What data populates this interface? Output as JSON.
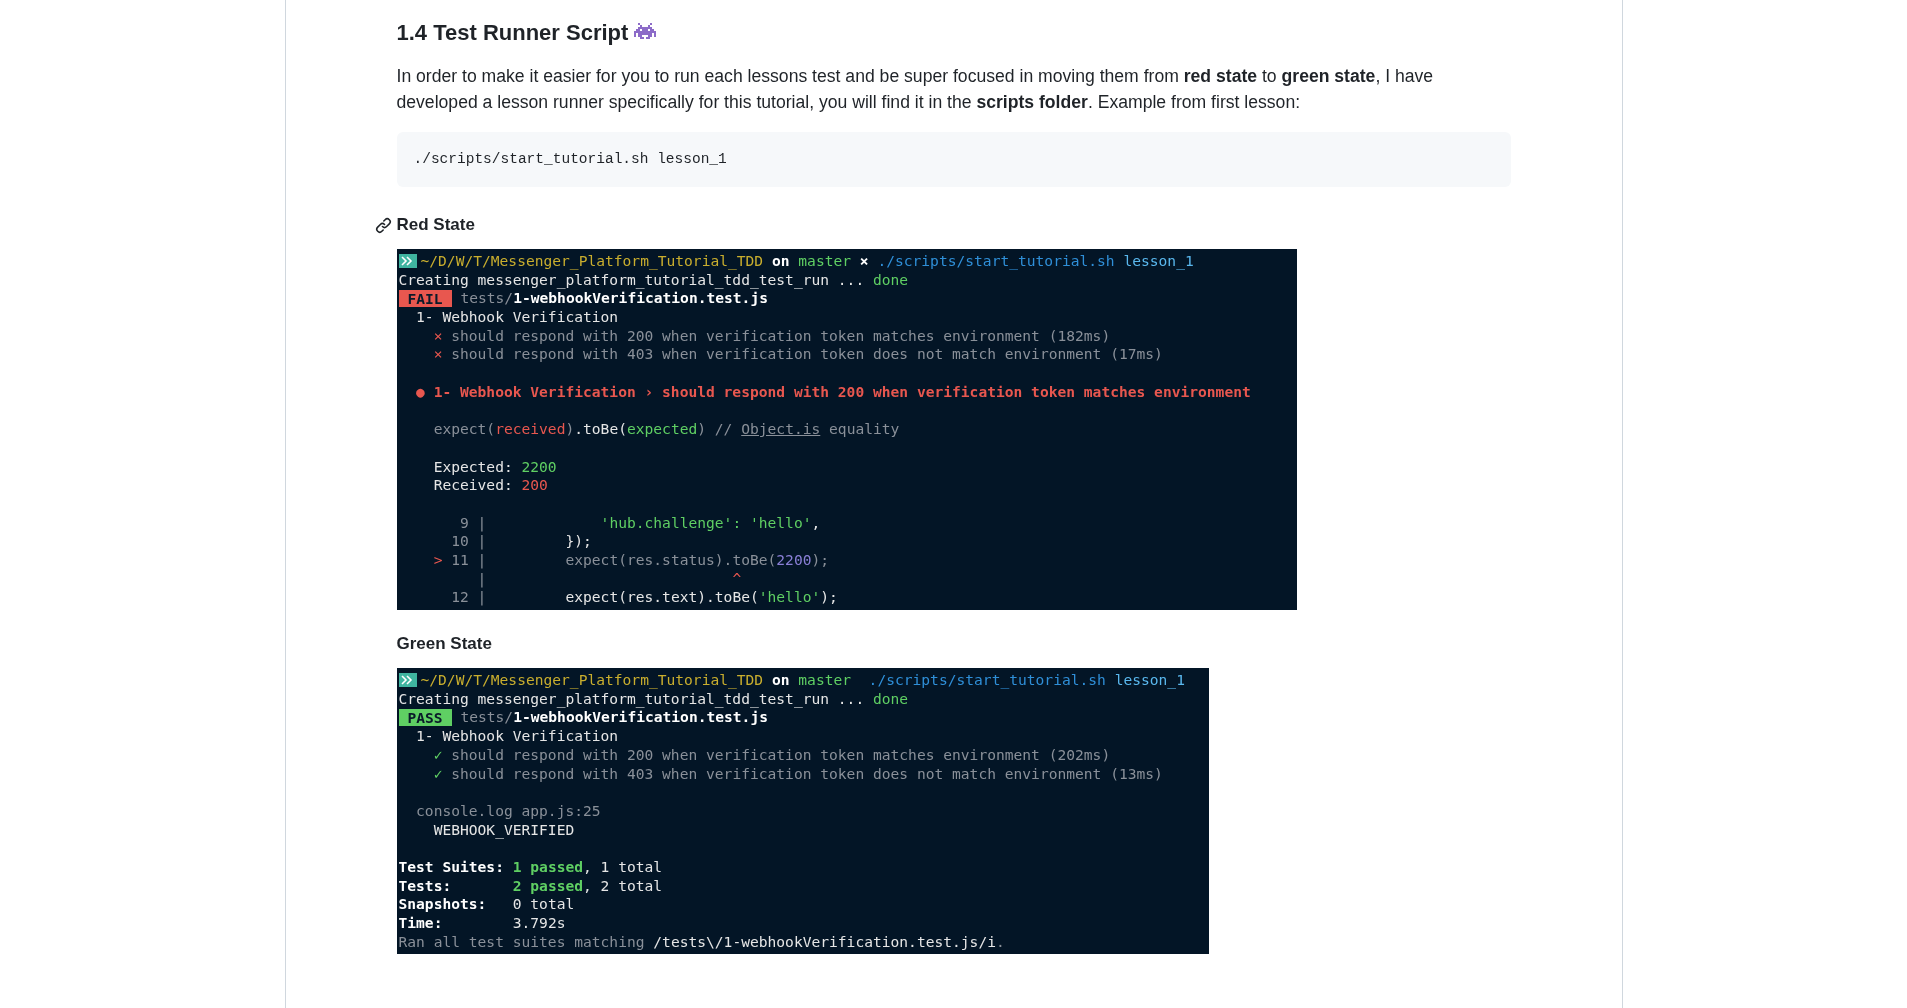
{
  "heading": "1.4 Test Runner Script",
  "intro": "In order to make it easier for you to run each lessons test and be super focused in moving them from **red state** to **green state**, I have developed a lesson runner specifically for this tutorial, you will find it in the **scripts folder**. Example from first lesson:",
  "code_block": "./scripts/start_tutorial.sh lesson_1",
  "sections": [
    {
      "title": "Red State",
      "anchor_shown": true,
      "terminal": {
        "lines": [
          {
            "kind": "prompt",
            "segments": [
              {
                "text": "~/D/W/T/Messenger_Platform_Tutorial_TDD",
                "kind": "yellow"
              },
              {
                "text": " on ",
                "kind": "bold"
              },
              {
                "text": "master",
                "kind": "green"
              },
              {
                "text": " × ",
                "kind": "bold"
              },
              {
                "text": "./scripts/start_tutorial.sh",
                "kind": "blue"
              },
              {
                "text": " lesson_1",
                "kind": "lightblue"
              }
            ]
          },
          {
            "kind": "text",
            "segments": [
              {
                "text": "Creating messenger_platform_tutorial_tdd_test_run ... ",
                "kind": "plain"
              },
              {
                "text": "done",
                "kind": "green"
              }
            ]
          },
          {
            "kind": "badge",
            "badge": {
              "text": "FAIL",
              "kind": "fail"
            },
            "segments": [
              {
                "text": " tests/",
                "kind": "dim"
              },
              {
                "text": "1-webhookVerification.test.js",
                "kind": "bold"
              }
            ]
          },
          {
            "kind": "text",
            "segments": [
              {
                "text": "  1- Webhook Verification",
                "kind": "plain"
              }
            ]
          },
          {
            "kind": "text",
            "segments": [
              {
                "text": "    × ",
                "kind": "red"
              },
              {
                "text": "should respond with 200 when verification token matches environment (182ms)",
                "kind": "dim"
              }
            ]
          },
          {
            "kind": "text",
            "segments": [
              {
                "text": "    × ",
                "kind": "red"
              },
              {
                "text": "should respond with 403 when verification token does not match environment (17ms)",
                "kind": "dim"
              }
            ]
          },
          {
            "kind": "blank"
          },
          {
            "kind": "text",
            "segments": [
              {
                "text": "  ● 1- Webhook Verification › should respond with 200 when verification token matches environment",
                "kind": "redbold"
              }
            ]
          },
          {
            "kind": "blank"
          },
          {
            "kind": "text",
            "segments": [
              {
                "text": "    expect(",
                "kind": "dim"
              },
              {
                "text": "received",
                "kind": "red"
              },
              {
                "text": ")",
                "kind": "dim"
              },
              {
                "text": ".toBe(",
                "kind": "plain"
              },
              {
                "text": "expected",
                "kind": "green"
              },
              {
                "text": ") // ",
                "kind": "dim"
              },
              {
                "text": "Object.is",
                "kind": "link"
              },
              {
                "text": " equality",
                "kind": "dim"
              }
            ]
          },
          {
            "kind": "blank"
          },
          {
            "kind": "text",
            "segments": [
              {
                "text": "    Expected: ",
                "kind": "plain"
              },
              {
                "text": "2200",
                "kind": "green"
              }
            ]
          },
          {
            "kind": "text",
            "segments": [
              {
                "text": "    Received: ",
                "kind": "plain"
              },
              {
                "text": "200",
                "kind": "red"
              }
            ]
          },
          {
            "kind": "blank"
          },
          {
            "kind": "text",
            "segments": [
              {
                "text": "       9 | ",
                "kind": "dim"
              },
              {
                "text": "            'hub.challenge': 'hello'",
                "kind": "green"
              },
              {
                "text": ",",
                "kind": "plain"
              }
            ]
          },
          {
            "kind": "text",
            "segments": [
              {
                "text": "      10 | ",
                "kind": "dim"
              },
              {
                "text": "        });",
                "kind": "plain"
              }
            ]
          },
          {
            "kind": "text",
            "segments": [
              {
                "text": "    > ",
                "kind": "red"
              },
              {
                "text": "11 | ",
                "kind": "dim"
              },
              {
                "text": "        expect(res.status).toBe(",
                "kind": "dim"
              },
              {
                "text": "2200",
                "kind": "purple"
              },
              {
                "text": ");",
                "kind": "dim"
              }
            ]
          },
          {
            "kind": "text",
            "segments": [
              {
                "text": "         | ",
                "kind": "dim"
              },
              {
                "text": "                           ^",
                "kind": "red"
              }
            ]
          },
          {
            "kind": "text",
            "segments": [
              {
                "text": "      12 | ",
                "kind": "dim"
              },
              {
                "text": "        expect(res.text).toBe(",
                "kind": "plain"
              },
              {
                "text": "'hello'",
                "kind": "green"
              },
              {
                "text": ");",
                "kind": "plain"
              }
            ]
          }
        ]
      }
    },
    {
      "title": "Green State",
      "anchor_shown": false,
      "terminal": {
        "lines": [
          {
            "kind": "prompt",
            "segments": [
              {
                "text": "~/D/W/T/Messenger_Platform_Tutorial_TDD",
                "kind": "yellow"
              },
              {
                "text": " on ",
                "kind": "bold"
              },
              {
                "text": "master",
                "kind": "green"
              },
              {
                "text": "  ./scripts/start_tutorial.sh",
                "kind": "blue"
              },
              {
                "text": " lesson_1",
                "kind": "lightblue"
              }
            ]
          },
          {
            "kind": "text",
            "segments": [
              {
                "text": "Creating messenger_platform_tutorial_tdd_test_run ... ",
                "kind": "plain"
              },
              {
                "text": "done",
                "kind": "green"
              }
            ]
          },
          {
            "kind": "badge",
            "badge": {
              "text": "PASS",
              "kind": "pass"
            },
            "segments": [
              {
                "text": " tests/",
                "kind": "dim"
              },
              {
                "text": "1-webhookVerification.test.js",
                "kind": "bold"
              }
            ]
          },
          {
            "kind": "text",
            "segments": [
              {
                "text": "  1- Webhook Verification",
                "kind": "plain"
              }
            ]
          },
          {
            "kind": "text",
            "segments": [
              {
                "text": "    ✓ ",
                "kind": "green"
              },
              {
                "text": "should respond with 200 when verification token matches environment (202ms)",
                "kind": "dim"
              }
            ]
          },
          {
            "kind": "text",
            "segments": [
              {
                "text": "    ✓ ",
                "kind": "green"
              },
              {
                "text": "should respond with 403 when verification token does not match environment (13ms)",
                "kind": "dim"
              }
            ]
          },
          {
            "kind": "blank"
          },
          {
            "kind": "text",
            "segments": [
              {
                "text": "  console.log app.js:25",
                "kind": "dim"
              }
            ]
          },
          {
            "kind": "text",
            "segments": [
              {
                "text": "    WEBHOOK_VERIFIED",
                "kind": "plain"
              }
            ]
          },
          {
            "kind": "blank"
          },
          {
            "kind": "text",
            "segments": [
              {
                "text": "Test Suites: ",
                "kind": "bold"
              },
              {
                "text": "1 passed",
                "kind": "greenbold"
              },
              {
                "text": ", 1 total",
                "kind": "plain"
              }
            ]
          },
          {
            "kind": "text",
            "segments": [
              {
                "text": "Tests:       ",
                "kind": "bold"
              },
              {
                "text": "2 passed",
                "kind": "greenbold"
              },
              {
                "text": ", 2 total",
                "kind": "plain"
              }
            ]
          },
          {
            "kind": "text",
            "segments": [
              {
                "text": "Snapshots:   ",
                "kind": "bold"
              },
              {
                "text": "0 total",
                "kind": "plain"
              }
            ]
          },
          {
            "kind": "text",
            "segments": [
              {
                "text": "Time:        ",
                "kind": "bold"
              },
              {
                "text": "3.792s",
                "kind": "plain"
              }
            ]
          },
          {
            "kind": "text",
            "segments": [
              {
                "text": "Ran all test suites matching ",
                "kind": "dim"
              },
              {
                "text": "/tests\\/1-webhookVerification.test.js/i",
                "kind": "plain"
              },
              {
                "text": ".",
                "kind": "dim"
              }
            ]
          }
        ]
      }
    }
  ]
}
